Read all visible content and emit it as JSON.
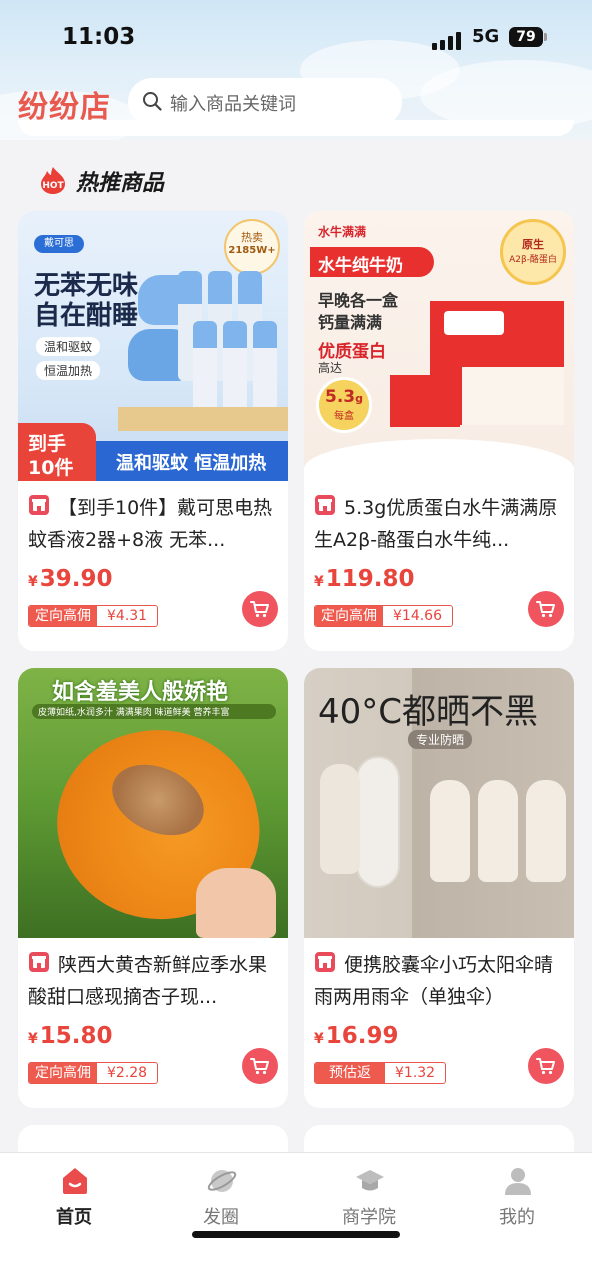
{
  "status_bar": {
    "time": "11:03",
    "network": "5G",
    "battery": "79"
  },
  "header": {
    "brand": "纷纷店",
    "search_placeholder": "输入商品关键词"
  },
  "section": {
    "title": "热推商品",
    "hot_badge": "HOT"
  },
  "products": [
    {
      "title": "【到手10件】戴可思电热蚊香液2器+8液 无苯...",
      "price_symbol": "¥",
      "price": "39.90",
      "badge_type": "定向高佣",
      "badge_value": "¥4.31",
      "image": {
        "brand": "戴可思",
        "headline_1": "无苯无味",
        "headline_2": "自在酣睡",
        "feature_1": "温和驱蚊",
        "feature_2": "恒温加热",
        "hot_label": "热卖",
        "hot_count": "2185W+",
        "corner_1": "到手",
        "corner_2": "10件",
        "banner": "温和驱蚊 恒温加热"
      }
    },
    {
      "title": "5.3g优质蛋白水牛满满原生A2β-酪蛋白水牛纯...",
      "price_symbol": "¥",
      "price": "119.80",
      "badge_type": "定向高佣",
      "badge_value": "¥14.66",
      "image": {
        "brand": "水牛满满",
        "ribbon": "水牛纯牛奶",
        "line_1": "早晚各一盒",
        "line_2": "钙量满满",
        "line_3": "优质蛋白",
        "line_4": "高达",
        "protein": "5.3",
        "protein_unit": "g",
        "per_box": "每盒",
        "seal_1": "原生",
        "seal_2": "A2β-酪蛋白"
      }
    },
    {
      "title": "陕西大黄杏新鲜应季水果酸甜口感现摘杏子现...",
      "price_symbol": "¥",
      "price": "15.80",
      "badge_type": "定向高佣",
      "badge_value": "¥2.28",
      "image": {
        "headline": "如含羞美人般娇艳",
        "subline": "皮薄如纸,水润多汁 满满果肉 味道鲜美 营养丰富"
      }
    },
    {
      "title": "便携胶囊伞小巧太阳伞晴雨两用雨伞（单独伞）",
      "price_symbol": "¥",
      "price": "16.99",
      "badge_type": "预估返",
      "badge_value": "¥1.32",
      "image": {
        "headline": "40°C都晒不黑",
        "tag": "专业防晒"
      }
    }
  ],
  "tabbar": {
    "items": [
      {
        "label": "首页",
        "icon": "home-icon",
        "active": true
      },
      {
        "label": "发圈",
        "icon": "planet-icon",
        "active": false
      },
      {
        "label": "商学院",
        "icon": "graduation-cap-icon",
        "active": false
      },
      {
        "label": "我的",
        "icon": "person-icon",
        "active": false
      }
    ]
  },
  "colors": {
    "accent": "#e8453c",
    "brand": "#e85a4f",
    "cart": "#f0545f"
  }
}
